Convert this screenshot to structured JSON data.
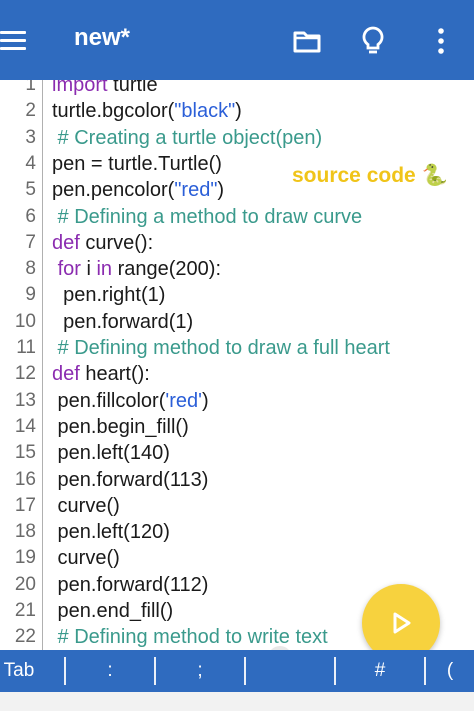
{
  "appbar": {
    "title": "new*",
    "icons": [
      "menu-icon",
      "folder-icon",
      "lightbulb-icon",
      "more-vert-icon"
    ]
  },
  "overlay": {
    "label": "source code 🐍"
  },
  "code": {
    "lines": [
      {
        "n": "1",
        "text": "import turtle"
      },
      {
        "n": "2",
        "text": "turtle.bgcolor(\"black\")"
      },
      {
        "n": "3",
        "text": " # Creating a turtle object(pen)"
      },
      {
        "n": "4",
        "text": "pen = turtle.Turtle()"
      },
      {
        "n": "5",
        "text": "pen.pencolor(\"red\")"
      },
      {
        "n": "6",
        "text": " # Defining a method to draw curve"
      },
      {
        "n": "7",
        "text": "def curve():"
      },
      {
        "n": "8",
        "text": " for i in range(200):"
      },
      {
        "n": "9",
        "text": "  pen.right(1)"
      },
      {
        "n": "10",
        "text": "  pen.forward(1)"
      },
      {
        "n": "11",
        "text": " # Defining method to draw a full heart"
      },
      {
        "n": "12",
        "text": "def heart():"
      },
      {
        "n": "13",
        "text": " pen.fillcolor('red')"
      },
      {
        "n": "14",
        "text": " pen.begin_fill()"
      },
      {
        "n": "15",
        "text": " pen.left(140)"
      },
      {
        "n": "16",
        "text": " pen.forward(113)"
      },
      {
        "n": "17",
        "text": " curve()"
      },
      {
        "n": "18",
        "text": " pen.left(120)"
      },
      {
        "n": "19",
        "text": " curve()"
      },
      {
        "n": "20",
        "text": " pen.forward(112)"
      },
      {
        "n": "21",
        "text": " pen.end_fill()"
      },
      {
        "n": "22",
        "text": " # Defining method to write text"
      }
    ]
  },
  "symbol_bar": {
    "keys": [
      "Tab",
      ":",
      ";",
      "#",
      "("
    ]
  },
  "colors": {
    "accent": "#2f6bbf",
    "fab": "#f7d23e",
    "overlay_text": "#f0c419",
    "keyword": "#8b2cb0",
    "string": "#2b5fd8",
    "comment": "#3a9a8c"
  }
}
